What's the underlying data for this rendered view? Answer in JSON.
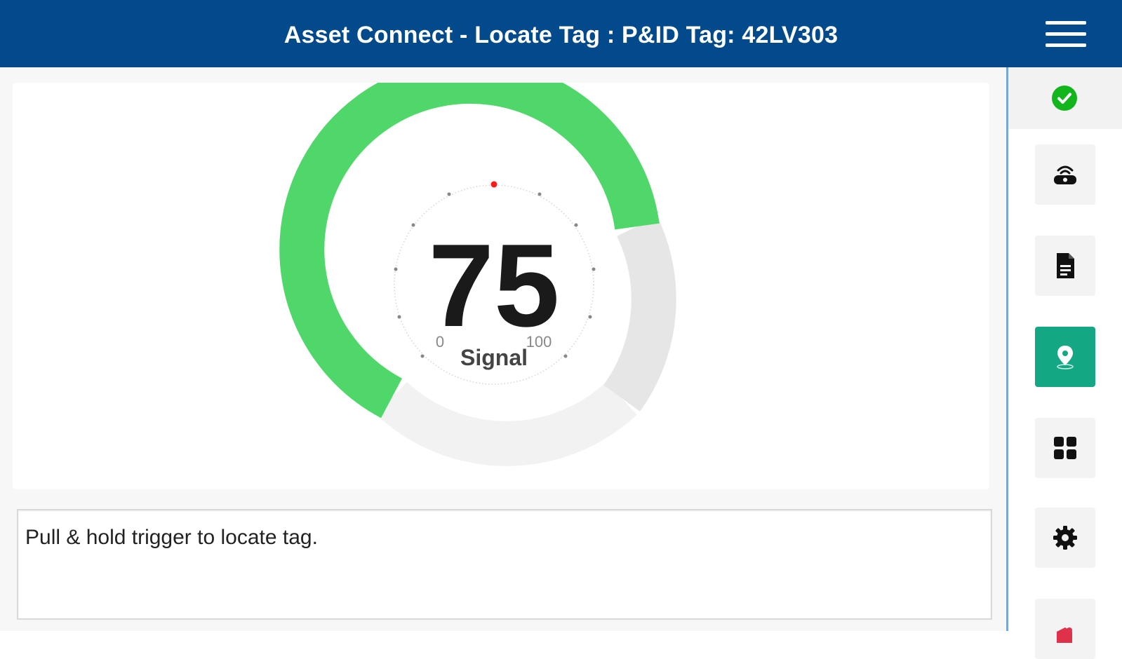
{
  "header": {
    "title": "Asset Connect - Locate Tag : P&ID Tag: 42LV303"
  },
  "gauge": {
    "value": "75",
    "caption": "Signal",
    "min_label": "0",
    "max_label": "100",
    "fraction": 0.75,
    "colors": {
      "fill": "#4fd769",
      "track_light": "#e6e6e6",
      "track_lighter": "#f2f2f2",
      "needle": "#ff1a1a"
    }
  },
  "message": {
    "text": "Pull & hold trigger to locate tag."
  },
  "sidebar": {
    "status_icon": "check-circle-icon",
    "status_color": "#12b51c",
    "accent_color": "#13a883",
    "buttons": [
      {
        "icon": "tag-reader-icon"
      },
      {
        "icon": "document-icon"
      },
      {
        "icon": "location-pin-icon",
        "active": true
      },
      {
        "icon": "grid-icon"
      },
      {
        "icon": "gear-icon"
      },
      {
        "icon": "partial-red-icon"
      }
    ]
  }
}
